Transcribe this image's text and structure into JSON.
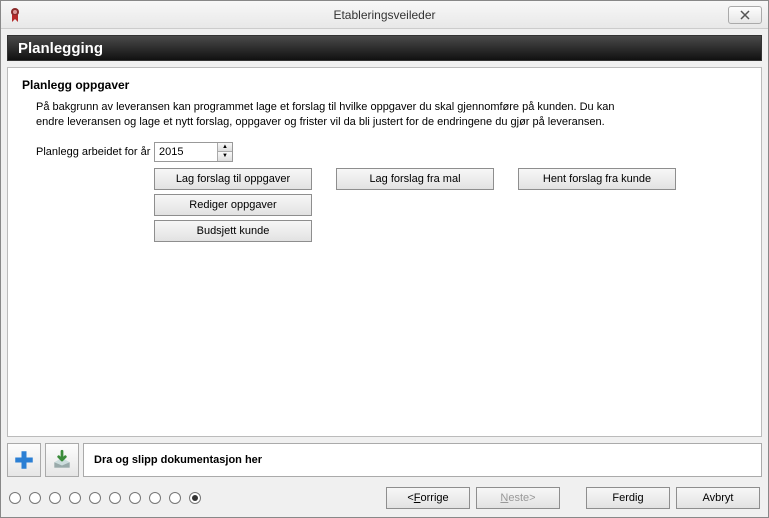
{
  "window": {
    "title": "Etableringsveileder"
  },
  "section": {
    "title": "Planlegging"
  },
  "panel": {
    "title": "Planlegg oppgaver",
    "description": "På bakgrunn av leveransen kan programmet lage et forslag til hvilke oppgaver du skal gjennomføre på kunden. Du kan endre leveransen og lage et nytt forslag, oppgaver og frister vil da bli justert for de endringene du gjør på leveransen.",
    "year_label": "Planlegg arbeidet for år",
    "year_value": "2015",
    "buttons": {
      "lag_forslag_oppgaver": "Lag forslag til oppgaver",
      "lag_forslag_mal": "Lag forslag fra mal",
      "hent_forslag_kunde": "Hent forslag fra kunde",
      "rediger_oppgaver": "Rediger oppgaver",
      "budsjett_kunde": "Budsjett kunde"
    }
  },
  "dropzone": {
    "text": "Dra og slipp dokumentasjon her"
  },
  "nav": {
    "prev": "Forrige",
    "next": "Neste",
    "finish": "Ferdig",
    "cancel": "Avbryt"
  },
  "steps": {
    "count": 10,
    "active": 10
  }
}
